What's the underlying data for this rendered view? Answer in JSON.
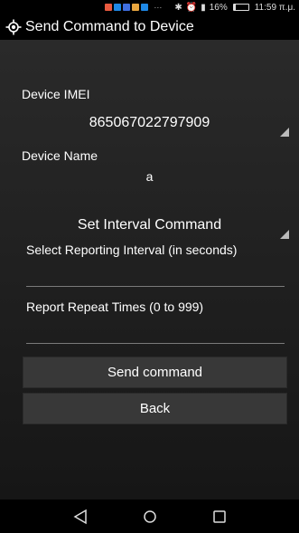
{
  "status_bar": {
    "icons": [
      "app-notification-icon",
      "app-notification-icon",
      "app-notification-icon",
      "app-notification-icon",
      "app-notification-icon"
    ],
    "more": "···",
    "battery_text": "16%",
    "battery_level": 0.16,
    "time": "11:59 π.μ."
  },
  "app_bar": {
    "title": "Send Command to Device",
    "icon": "crosshair-icon"
  },
  "form": {
    "imei_label": "Device IMEI",
    "imei_value": "865067022797909",
    "name_label": "Device Name",
    "name_value": "a",
    "command_value": "Set Interval Command",
    "interval_label": "Select Reporting Interval (in seconds)",
    "interval_value": "",
    "repeat_label": "Report Repeat Times (0 to 999)",
    "repeat_value": ""
  },
  "buttons": {
    "send": "Send command",
    "back": "Back"
  },
  "nav": {
    "back": "back-icon",
    "home": "home-icon",
    "recents": "recents-icon"
  },
  "colors": {
    "background_top": "#2a2a2a",
    "background_bottom": "#161616",
    "button": "#383838"
  }
}
